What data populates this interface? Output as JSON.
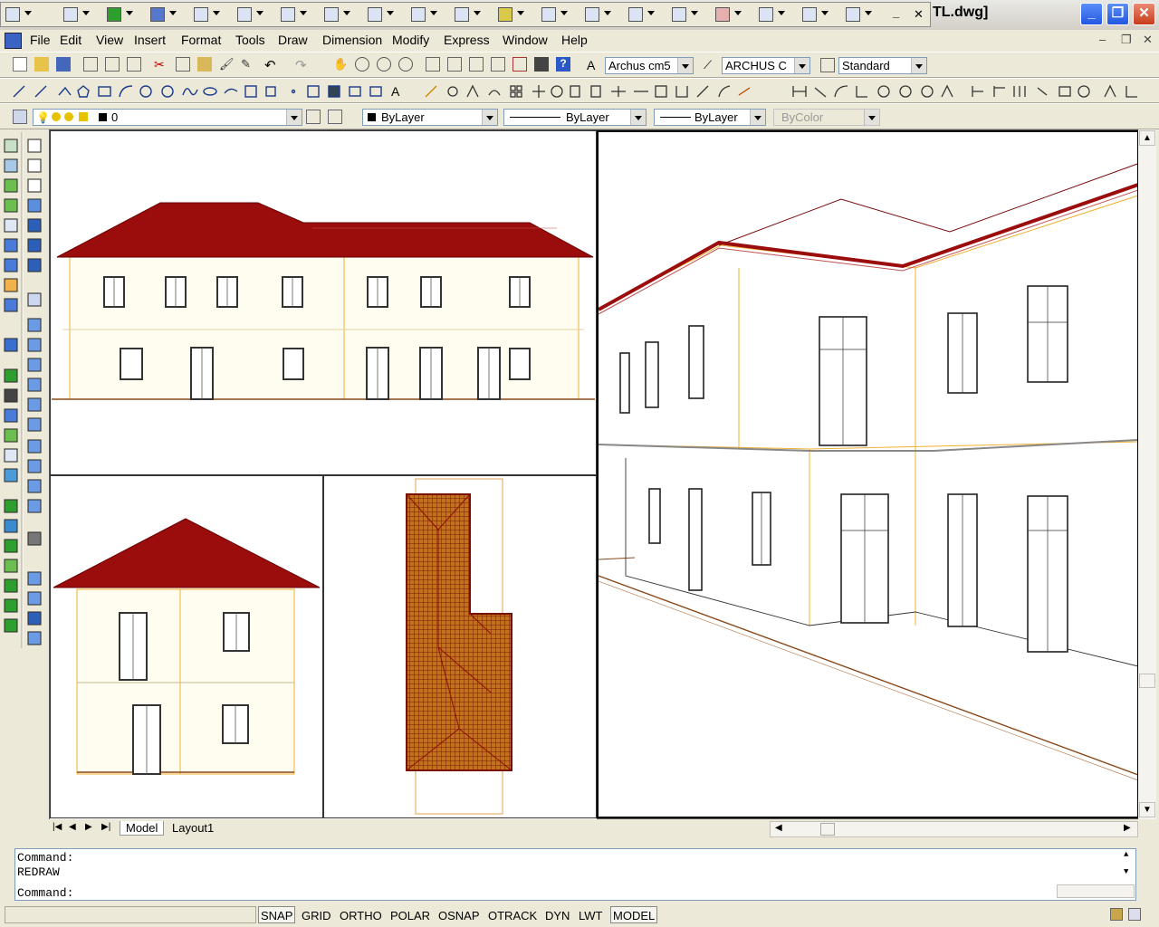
{
  "window": {
    "title": "TL.dwg]",
    "minimize_label": "_",
    "maximize_label": "❐",
    "close_label": "✕"
  },
  "floating_toolbar": {
    "minimize_label": "_",
    "close_label": "✕"
  },
  "menu": {
    "items": [
      "File",
      "Edit",
      "View",
      "Insert",
      "Format",
      "Tools",
      "Draw",
      "Dimension",
      "Modify",
      "Express",
      "Window",
      "Help"
    ]
  },
  "styles_toolbar": {
    "text_style": "Archus cm5",
    "dim_style": "ARCHUS C",
    "table_style": "Standard"
  },
  "layers_toolbar": {
    "current_layer": "0",
    "color": "ByLayer",
    "linetype": "ByLayer",
    "lineweight": "ByLayer",
    "plot_style": "ByColor"
  },
  "tabs": {
    "model": "Model",
    "layout1": "Layout1"
  },
  "command": {
    "line1": "Command:",
    "line2": "REDRAW",
    "prompt": "Command:"
  },
  "status": {
    "toggles": [
      "SNAP",
      "GRID",
      "ORTHO",
      "POLAR",
      "OSNAP",
      "OTRACK",
      "DYN",
      "LWT",
      "MODEL"
    ]
  },
  "colors": {
    "roof": "#9b0d0d",
    "wall_line": "#f0b030",
    "ground": "#8a4a1a"
  }
}
